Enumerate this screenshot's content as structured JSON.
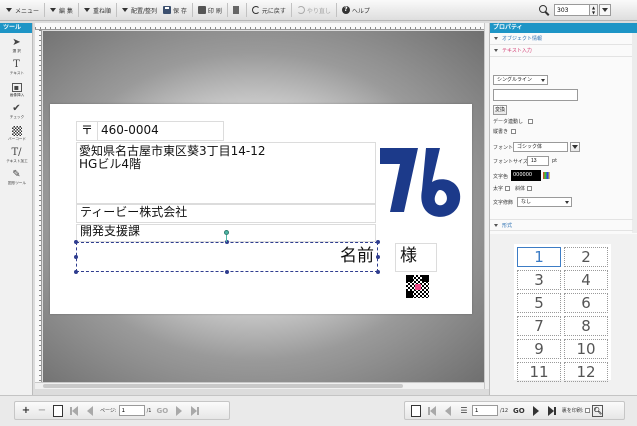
{
  "toolbar": {
    "menu": "メニュー",
    "edit": "編 集",
    "layer": "重ね順",
    "arrange": "配置/整列",
    "save": "保 存",
    "print": "印 刷",
    "undo": "元に戻す",
    "redo": "やり直し",
    "help": "ヘルプ",
    "zoom_value": "303"
  },
  "tools": {
    "header": "ツール",
    "items": [
      {
        "label": "選 択",
        "icon": "pointer-icon"
      },
      {
        "label": "テキスト",
        "icon": "text-tool-icon"
      },
      {
        "label": "画像挿入",
        "icon": "image-insert-icon"
      },
      {
        "label": "チェック",
        "icon": "check-icon"
      },
      {
        "label": "バーコード",
        "icon": "barcode-icon"
      },
      {
        "label": "テキスト加工",
        "icon": "text-effect-icon"
      },
      {
        "label": "図形ツール",
        "icon": "shape-tool-icon"
      }
    ]
  },
  "card": {
    "postal_mark": "〒",
    "postal_code": "460-0004",
    "address_line1": "愛知県名古屋市東区葵3丁目14-12",
    "address_line2": "HGビル4階",
    "company": "ティービー株式会社",
    "department": "開発支援課",
    "name": "名前",
    "honorific": "様",
    "logo_color": "#1c3a8a"
  },
  "properties": {
    "header": "プロパティ",
    "object_info": "オブジェクト情報",
    "text_input": "テキスト入力",
    "line_mode": "シングルライン",
    "text_value": "",
    "convert_button": "変換",
    "data_link_label": "データ連動し",
    "vertical_label": "縦書き",
    "font_label": "フォント",
    "font_value": "ゴシック体",
    "font_size_label": "フォントサイズ",
    "font_size_value": "13",
    "font_size_unit": "pt",
    "text_color_label": "文字色",
    "text_color_value": "000000",
    "bold_label": "太字",
    "italic_label": "斜体",
    "decoration_label": "文字修飾",
    "decoration_value": "なし",
    "shape_section": "形式"
  },
  "page_grid": {
    "pages": [
      "1",
      "2",
      "3",
      "4",
      "5",
      "6",
      "7",
      "8",
      "9",
      "10",
      "11",
      "12"
    ],
    "active": "1"
  },
  "bottom_left": {
    "page_label": "ページ:",
    "page_value": "1",
    "page_total": "/1",
    "go": "GO"
  },
  "bottom_right": {
    "page_value": "1",
    "page_total": "/12",
    "go": "GO",
    "print_label": "裏を印刷:"
  }
}
